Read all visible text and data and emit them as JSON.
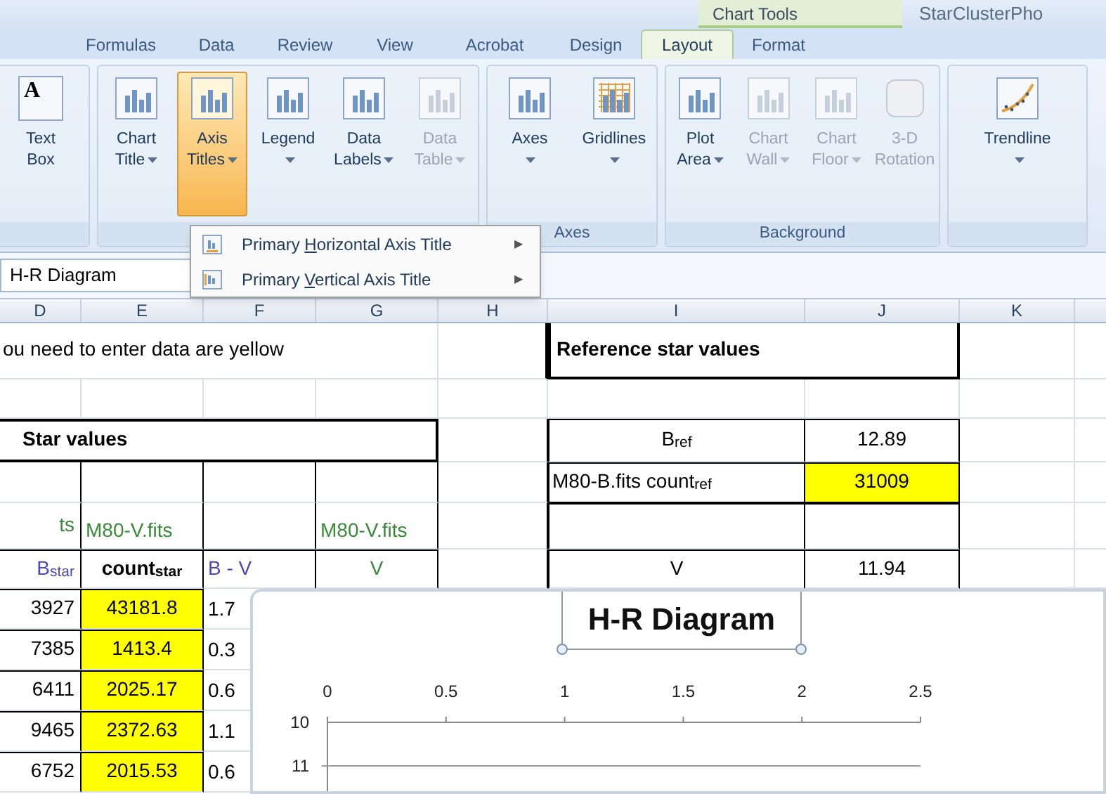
{
  "title_bar": {
    "contextual_group": "Chart Tools",
    "document_title": "StarClusterPho"
  },
  "ribbon_tabs": [
    {
      "label": "Formulas",
      "selected": false
    },
    {
      "label": "Data",
      "selected": false
    },
    {
      "label": "Review",
      "selected": false
    },
    {
      "label": "View",
      "selected": false
    },
    {
      "label": "Acrobat",
      "selected": false
    },
    {
      "label": "Design",
      "selected": false
    },
    {
      "label": "Layout",
      "selected": true
    },
    {
      "label": "Format",
      "selected": false
    }
  ],
  "ribbon_groups": [
    {
      "buttons": [
        {
          "kind": "textbox",
          "icon_text": "A",
          "lines": [
            "Text",
            "Box"
          ],
          "dropdown": false,
          "pressed": false,
          "disabled": false
        }
      ]
    },
    {
      "buttons": [
        {
          "kind": "chart",
          "lines": [
            "Chart",
            "Title"
          ],
          "dropdown": true,
          "pressed": false,
          "disabled": false
        },
        {
          "kind": "chart",
          "lines": [
            "Axis",
            "Titles"
          ],
          "dropdown": true,
          "pressed": true,
          "disabled": false
        },
        {
          "kind": "chart",
          "lines": [
            "Legend"
          ],
          "dropdown": true,
          "pressed": false,
          "disabled": false
        },
        {
          "kind": "chart",
          "lines": [
            "Data",
            "Labels"
          ],
          "dropdown": true,
          "pressed": false,
          "disabled": false
        },
        {
          "kind": "chart",
          "lines": [
            "Data",
            "Table"
          ],
          "dropdown": true,
          "pressed": false,
          "disabled": true
        }
      ]
    },
    {
      "label": "Axes",
      "buttons": [
        {
          "kind": "chart",
          "lines": [
            "Axes"
          ],
          "dropdown": true,
          "pressed": false,
          "disabled": false
        },
        {
          "kind": "grid",
          "lines": [
            "Gridlines"
          ],
          "dropdown": true,
          "pressed": false,
          "disabled": false
        }
      ]
    },
    {
      "label": "Background",
      "buttons": [
        {
          "kind": "chart",
          "lines": [
            "Plot",
            "Area"
          ],
          "dropdown": true,
          "pressed": false,
          "disabled": false
        },
        {
          "kind": "chart",
          "lines": [
            "Chart",
            "Wall"
          ],
          "dropdown": true,
          "pressed": false,
          "disabled": true
        },
        {
          "kind": "chart",
          "lines": [
            "Chart",
            "Floor"
          ],
          "dropdown": true,
          "pressed": false,
          "disabled": true
        },
        {
          "kind": "cube",
          "lines": [
            "3-D",
            "Rotation"
          ],
          "dropdown": false,
          "pressed": false,
          "disabled": true
        }
      ]
    },
    {
      "buttons": [
        {
          "kind": "trend",
          "lines": [
            "Trendline"
          ],
          "dropdown": true,
          "pressed": false,
          "disabled": false
        }
      ]
    }
  ],
  "dropdown_menu": {
    "items": [
      {
        "before": "Primary ",
        "access_key": "H",
        "after": "orizontal Axis Title",
        "arrow": "▶"
      },
      {
        "before": "Primary ",
        "access_key": "V",
        "after": "ertical Axis Title",
        "arrow": "▶"
      }
    ]
  },
  "name_box": {
    "value": "H-R Diagram"
  },
  "sheet": {
    "columns": [
      "D",
      "E",
      "F",
      "G",
      "H",
      "I",
      "J",
      "K"
    ],
    "rows": [
      [
        {
          "text": "ou need to enter data are yellow"
        },
        {},
        {},
        {},
        {},
        {
          "text": "Reference star values",
          "bold": true
        },
        {},
        {}
      ],
      [
        {},
        {},
        {},
        {},
        {},
        {},
        {},
        {}
      ],
      [
        {
          "text": "Star values",
          "bold": true
        },
        {},
        {},
        {},
        {},
        {
          "text": "B$_{ref}$"
        },
        {
          "text": "12.89"
        },
        {}
      ],
      [
        {},
        {},
        {},
        {},
        {},
        {
          "text": "M80-B.fits count$_{ref}$"
        },
        {
          "text": "31009",
          "input": true
        },
        {}
      ],
      [
        {
          "text": "ts",
          "color": "#3a8a3a"
        },
        {
          "text": "M80-V.fits",
          "color": "#3a8a3a"
        },
        {},
        {
          "text": "M80-V.fits",
          "color": "#3a8a3a"
        },
        {},
        {},
        {},
        {}
      ],
      [
        {
          "text": "B$_{star}$",
          "color": "#4a4ab0"
        },
        {
          "text": "count$_{star}$",
          "bold": true
        },
        {
          "text": "B - V",
          "color": "#4a4ab0"
        },
        {
          "text": "V",
          "color": "#3a8a3a"
        },
        {},
        {
          "text": "V"
        },
        {
          "text": "11.94"
        },
        {}
      ],
      [
        {
          "text": "3927"
        },
        {
          "text": "43181.8",
          "input": true
        },
        {
          "text": "1.7"
        },
        {},
        {},
        {},
        {},
        {}
      ],
      [
        {
          "text": "7385"
        },
        {
          "text": "1413.4",
          "input": true
        },
        {
          "text": "0.3"
        },
        {},
        {},
        {},
        {},
        {}
      ],
      [
        {
          "text": "6411"
        },
        {
          "text": "2025.17",
          "input": true
        },
        {
          "text": "0.6"
        },
        {},
        {},
        {},
        {},
        {}
      ],
      [
        {
          "text": "9465"
        },
        {
          "text": "2372.63",
          "input": true
        },
        {
          "text": "1.1"
        },
        {},
        {},
        {},
        {},
        {}
      ],
      [
        {
          "text": "6752"
        },
        {
          "text": "2015.53",
          "input": true
        },
        {
          "text": "0.6"
        },
        {},
        {},
        {},
        {},
        {}
      ]
    ]
  },
  "chart": {
    "title_selected": true,
    "chart_data": {
      "type": "scatter",
      "title": "H-R Diagram",
      "xlim": [
        0,
        2.5
      ],
      "ylim": [
        11,
        10
      ],
      "xticks": [
        0,
        0.5,
        1,
        1.5,
        2,
        2.5
      ],
      "yticks": [
        10,
        11
      ]
    }
  }
}
